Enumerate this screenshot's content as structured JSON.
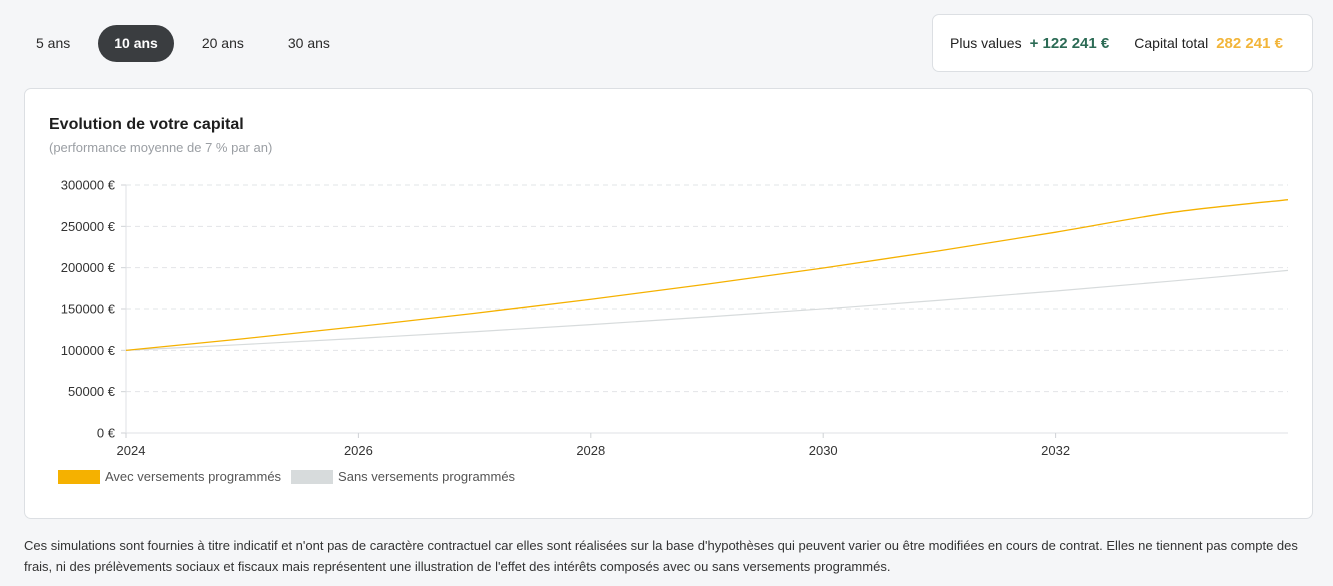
{
  "tabs": [
    {
      "label": "5 ans",
      "active": false
    },
    {
      "label": "10 ans",
      "active": true
    },
    {
      "label": "20 ans",
      "active": false
    },
    {
      "label": "30 ans",
      "active": false
    }
  ],
  "summary": {
    "gain_label": "Plus values",
    "gain_value": "+ 122 241 €",
    "total_label": "Capital total",
    "total_value": "282 241 €"
  },
  "colors": {
    "with_contributions": "#f5b100",
    "without_contributions": "#d7dbdc"
  },
  "chart_data": {
    "type": "line",
    "title": "Evolution de votre capital",
    "subtitle": "(performance moyenne de 7 % par an)",
    "ylim": [
      0,
      300000
    ],
    "yticks": [
      0,
      50000,
      100000,
      150000,
      200000,
      250000,
      300000
    ],
    "ytick_labels": [
      "0 €",
      "50000 €",
      "100000 €",
      "150000 €",
      "200000 €",
      "250000 €",
      "300000 €"
    ],
    "xticks": [
      2024,
      2026,
      2028,
      2030,
      2032
    ],
    "xtick_labels": [
      "2024",
      "2026",
      "2028",
      "2030",
      "2032"
    ],
    "xlim": [
      2024,
      2034
    ],
    "grid": true,
    "legend_position": "bottom-left",
    "x": [
      2024,
      2025,
      2026,
      2027,
      2028,
      2029,
      2030,
      2031,
      2032,
      2033,
      2034
    ],
    "series": [
      {
        "name": "Avec versements programmés",
        "values": [
          100000,
          113900,
          128800,
          144700,
          161800,
          180100,
          199600,
          220500,
          242900,
          266800,
          282241
        ]
      },
      {
        "name": "Sans versements programmés",
        "values": [
          100000,
          107000,
          114500,
          122500,
          131100,
          140300,
          150100,
          160600,
          171800,
          183800,
          196700
        ]
      }
    ]
  },
  "disclaimer": "Ces simulations sont fournies à titre indicatif et n'ont pas de caractère contractuel car elles sont réalisées sur la base d'hypothèses qui peuvent varier ou être modifiées en cours de contrat. Elles ne tiennent pas compte des frais, ni des prélèvements sociaux et fiscaux mais représentent une illustration de l'effet des intérêts composés avec ou sans versements programmés."
}
